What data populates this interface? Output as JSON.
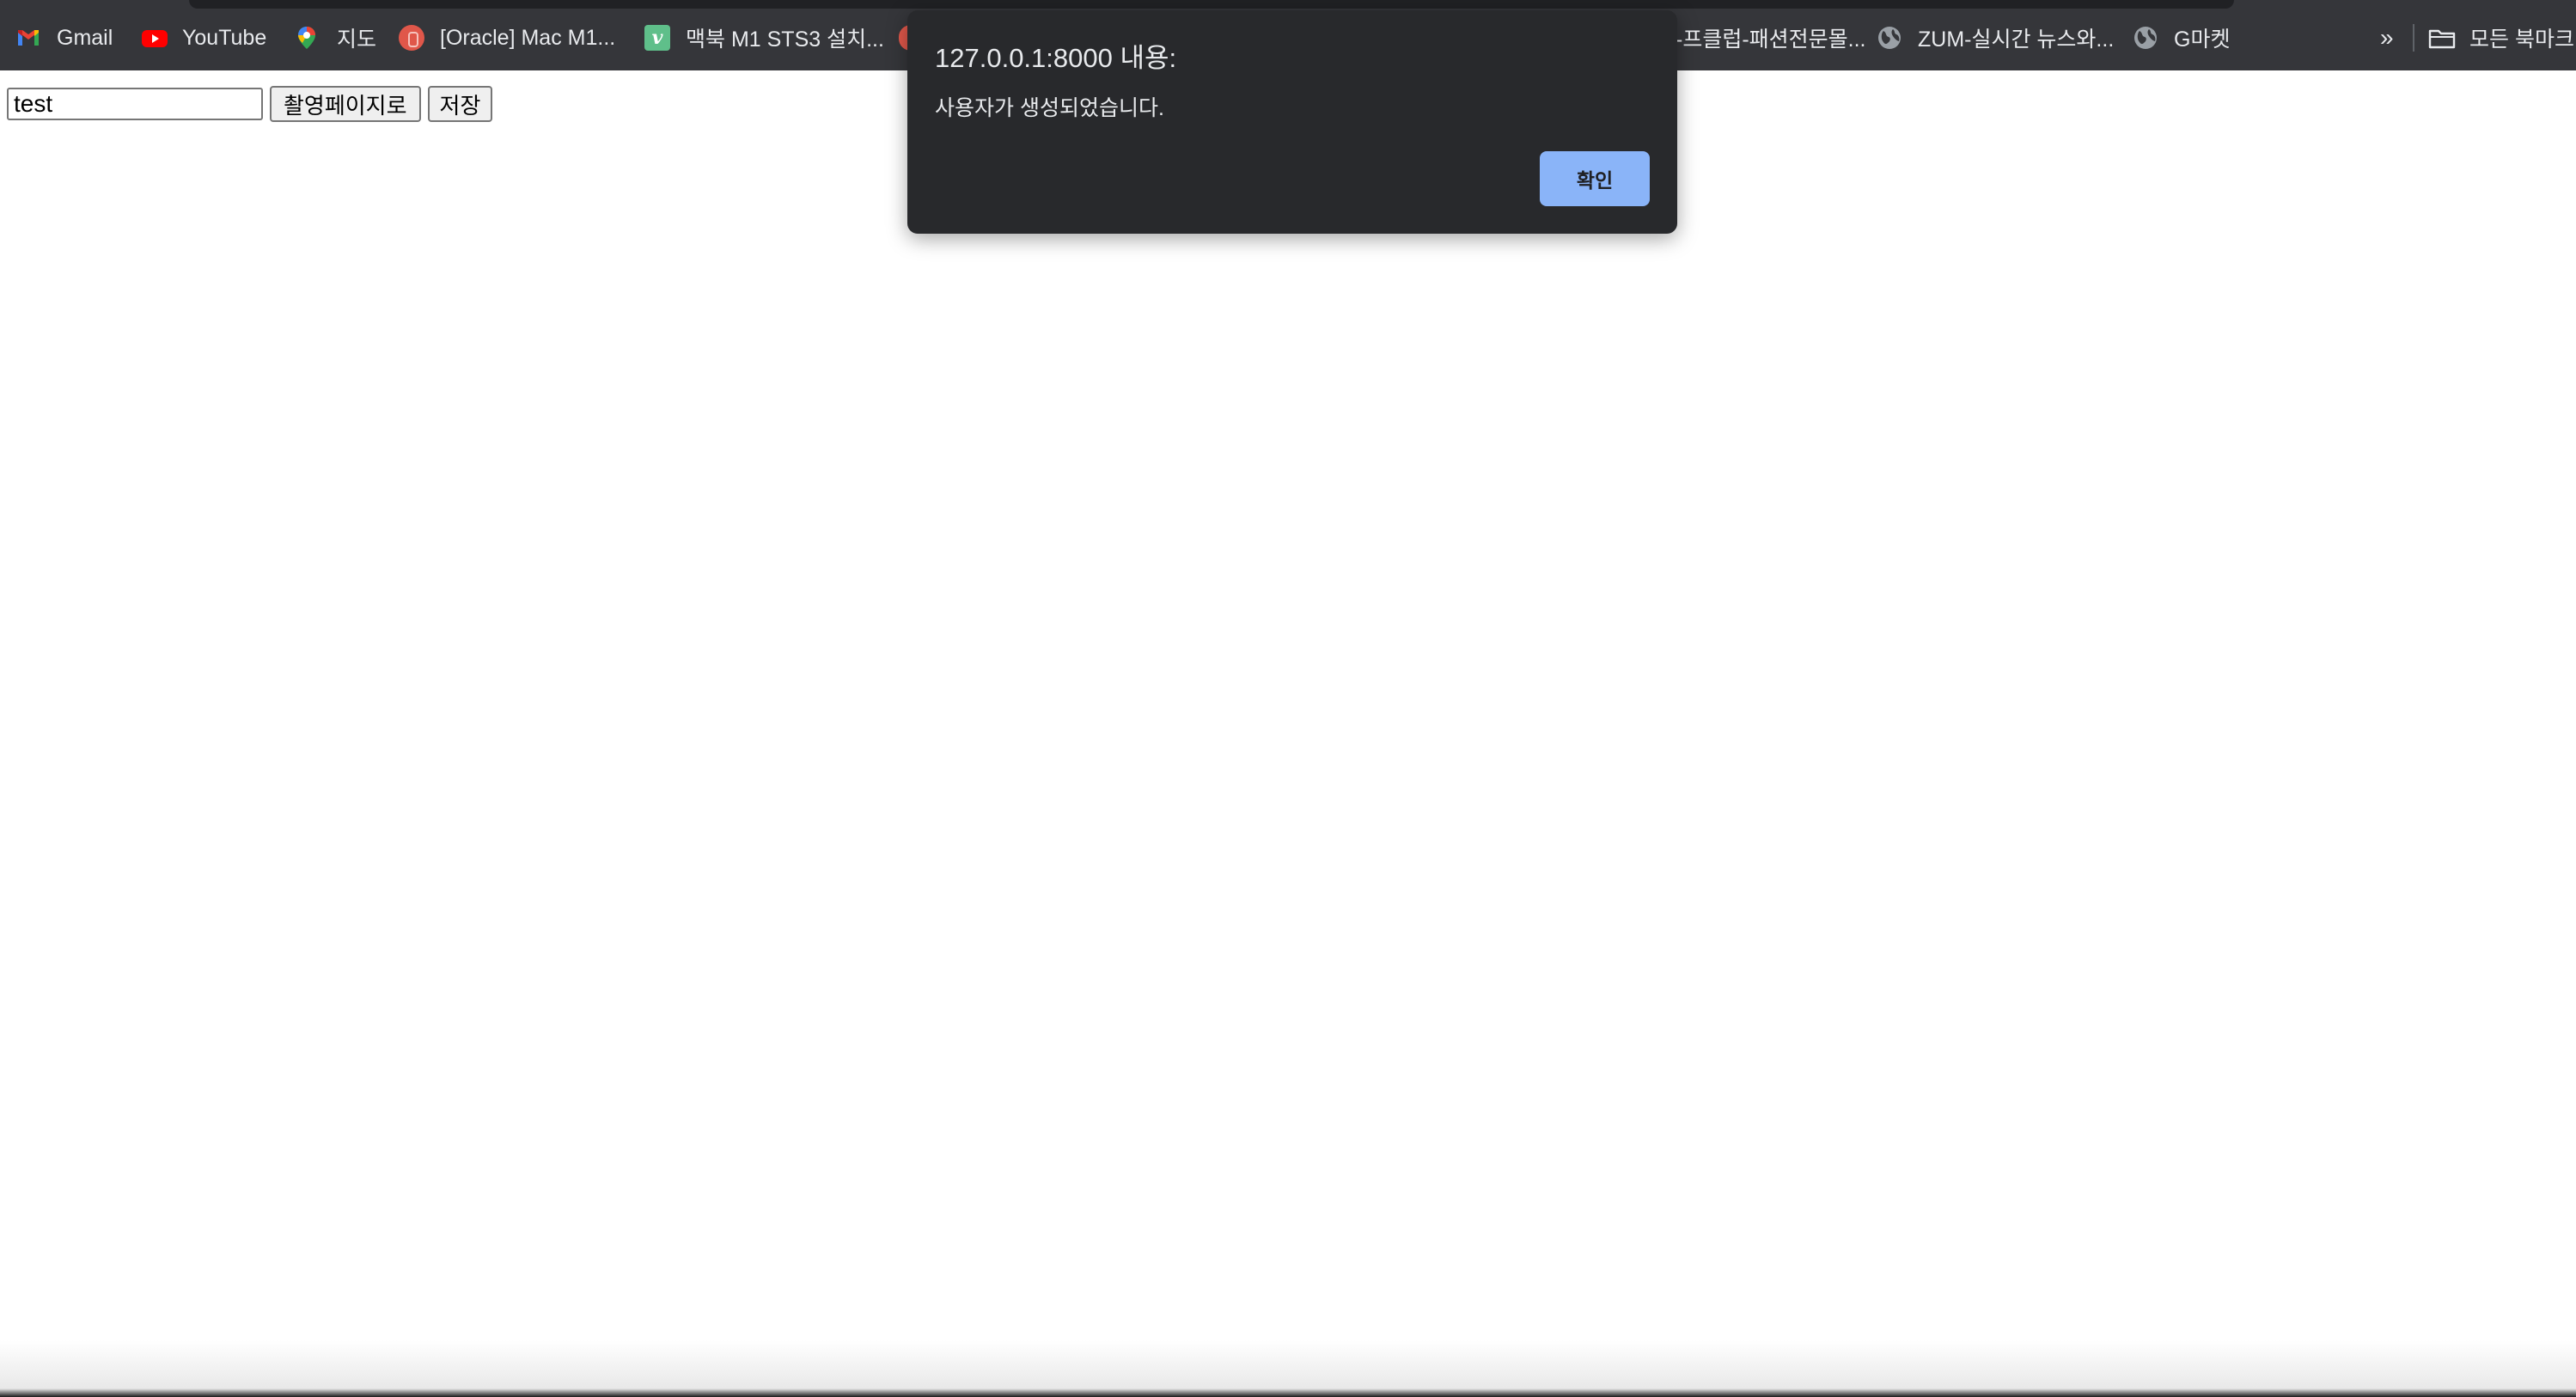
{
  "bookmarks_bar": {
    "items": [
      {
        "label": "Gmail",
        "icon": "gmail-icon"
      },
      {
        "label": "YouTube",
        "icon": "youtube-icon"
      },
      {
        "label": "지도",
        "icon": "maps-pin-icon"
      },
      {
        "label": "[Oracle] Mac M1...",
        "icon": "oracle-icon"
      },
      {
        "label": "맥북 M1 STS3 설치...",
        "icon": "v-icon"
      },
      {
        "label": "-프클럽-패션전문몰...",
        "icon": ""
      },
      {
        "label": "ZUM-실시간 뉴스와...",
        "icon": "globe-icon"
      },
      {
        "label": "G마켓",
        "icon": "globe-icon"
      }
    ],
    "overflow_label": "»",
    "all_bookmarks_label": "모든 북마크"
  },
  "page": {
    "name_input_value": "test",
    "capture_page_button": "촬영페이지로",
    "save_button": "저장"
  },
  "alert_dialog": {
    "title": "127.0.0.1:8000 내용:",
    "message": "사용자가 생성되었습니다.",
    "ok_button": "확인",
    "ok_color": "#8ab4f8",
    "background_color": "#28292c"
  }
}
